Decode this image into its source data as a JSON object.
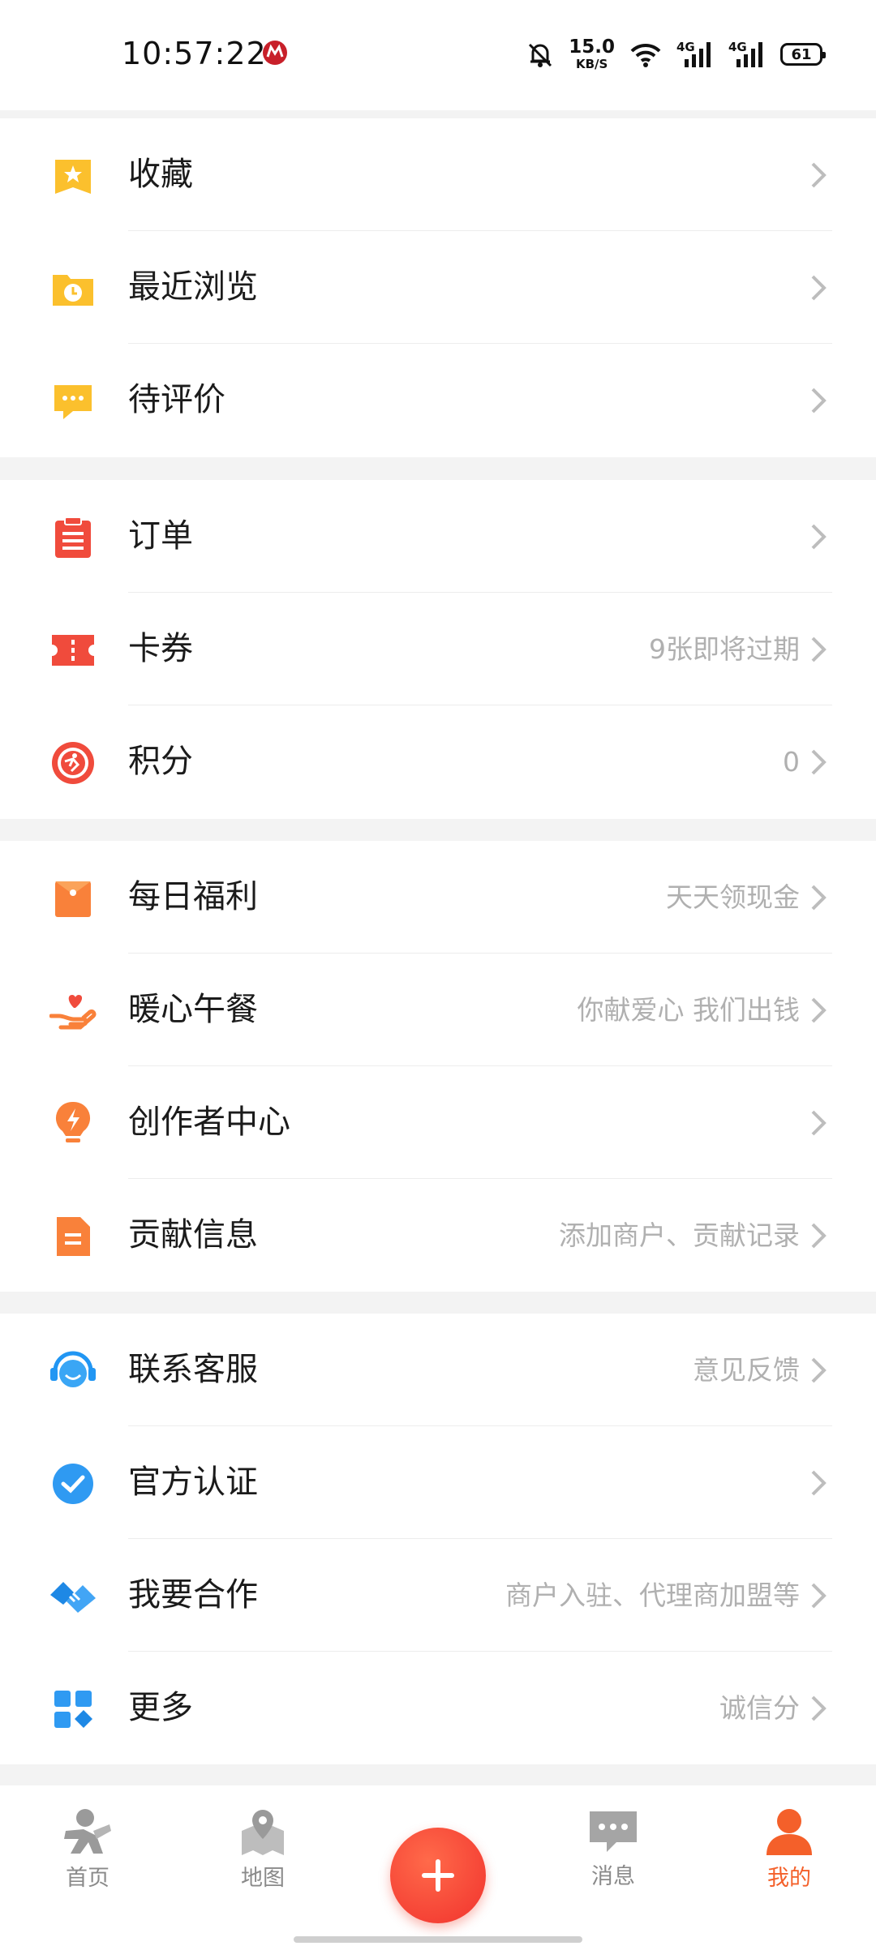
{
  "status_bar": {
    "time": "10:57:22",
    "net_speed_value": "15.0",
    "net_speed_unit": "KB/S",
    "sim1_label": "4G",
    "sim2_label": "4G",
    "battery_level": "61"
  },
  "menu": {
    "section1": [
      {
        "icon": "star-bookmark-icon",
        "label": "收藏",
        "right": ""
      },
      {
        "icon": "folder-clock-icon",
        "label": "最近浏览",
        "right": ""
      },
      {
        "icon": "comment-bubble-icon",
        "label": "待评价",
        "right": ""
      }
    ],
    "section2": [
      {
        "icon": "clipboard-order-icon",
        "label": "订单",
        "right": ""
      },
      {
        "icon": "ticket-icon",
        "label": "卡券",
        "right": "9张即将过期"
      },
      {
        "icon": "points-badge-icon",
        "label": "积分",
        "right": "0"
      }
    ],
    "section3": [
      {
        "icon": "red-envelope-icon",
        "label": "每日福利",
        "right": "天天领现金"
      },
      {
        "icon": "heart-hand-icon",
        "label": "暖心午餐",
        "right": "你献爱心 我们出钱"
      },
      {
        "icon": "lightbulb-bolt-icon",
        "label": "创作者中心",
        "right": ""
      },
      {
        "icon": "document-contribute-icon",
        "label": "贡献信息",
        "right": "添加商户、贡献记录"
      }
    ],
    "section4": [
      {
        "icon": "headset-service-icon",
        "label": "联系客服",
        "right": "意见反馈"
      },
      {
        "icon": "check-verified-icon",
        "label": "官方认证",
        "right": ""
      },
      {
        "icon": "handshake-icon",
        "label": "我要合作",
        "right": "商户入驻、代理商加盟等"
      },
      {
        "icon": "grid-more-icon",
        "label": "更多",
        "right": "诚信分"
      }
    ]
  },
  "tabbar": {
    "home": "首页",
    "map": "地图",
    "messages": "消息",
    "mine": "我的"
  },
  "colors": {
    "accent": "#f4602a",
    "fab": "#f1322d",
    "secondary_text": "#b0b0b0",
    "background": "#f3f3f3"
  }
}
